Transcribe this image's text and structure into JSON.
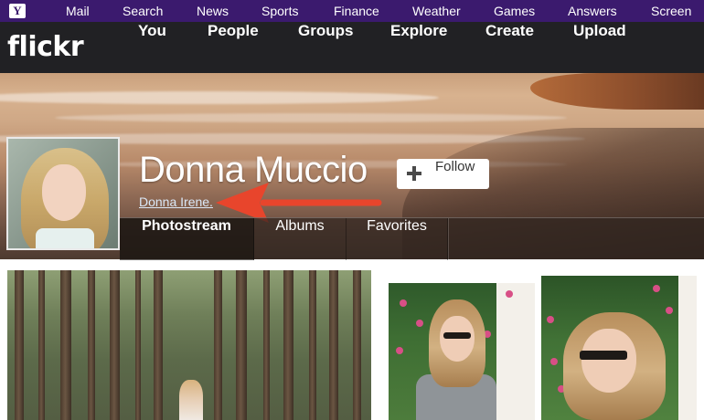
{
  "yahoo_bar": {
    "logo": "Y",
    "items": [
      "Mail",
      "Search",
      "News",
      "Sports",
      "Finance",
      "Weather",
      "Games",
      "Answers",
      "Screen"
    ]
  },
  "flickr_bar": {
    "logo": "flickr",
    "items": [
      "You",
      "People",
      "Groups",
      "Explore",
      "Create",
      "Upload"
    ]
  },
  "profile": {
    "name": "Donna Muccio",
    "real_name": "Donna Irene.",
    "follow_label": "Follow"
  },
  "tabs": [
    "Photostream",
    "Albums",
    "Favorites"
  ],
  "colors": {
    "yahoo_purple": "#3b1a6e",
    "flickr_dark": "#212124",
    "annotation_arrow": "#e8452c"
  },
  "icons": {
    "follow": "plus-icon",
    "annotation": "red-arrow-pointer"
  }
}
